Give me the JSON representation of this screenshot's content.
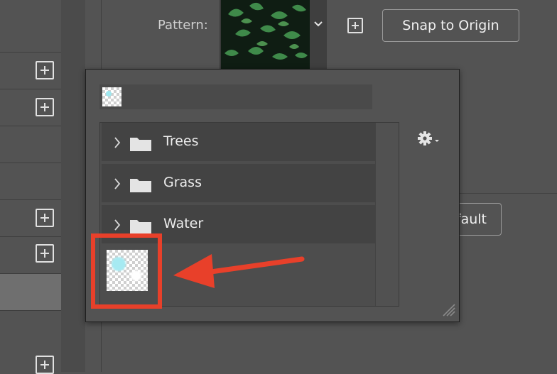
{
  "pattern_field": {
    "label": "Pattern:"
  },
  "toolbar": {
    "snap_button_label": "Snap to Origin",
    "default_button_label": "fault"
  },
  "pattern_picker": {
    "folders": [
      {
        "name": "Trees"
      },
      {
        "name": "Grass"
      },
      {
        "name": "Water"
      }
    ]
  },
  "colors": {
    "panel_bg": "#535353",
    "popup_bg": "#535353",
    "row_bg": "#434343",
    "annotation_red": "#e8402a",
    "accent_cyan": "#a6eaf2"
  },
  "icons": [
    "plus-square-icon",
    "chevron-down-icon",
    "chevron-right-icon",
    "folder-icon",
    "gear-icon",
    "resize-grip-icon",
    "arrow-annotation-icon"
  ]
}
